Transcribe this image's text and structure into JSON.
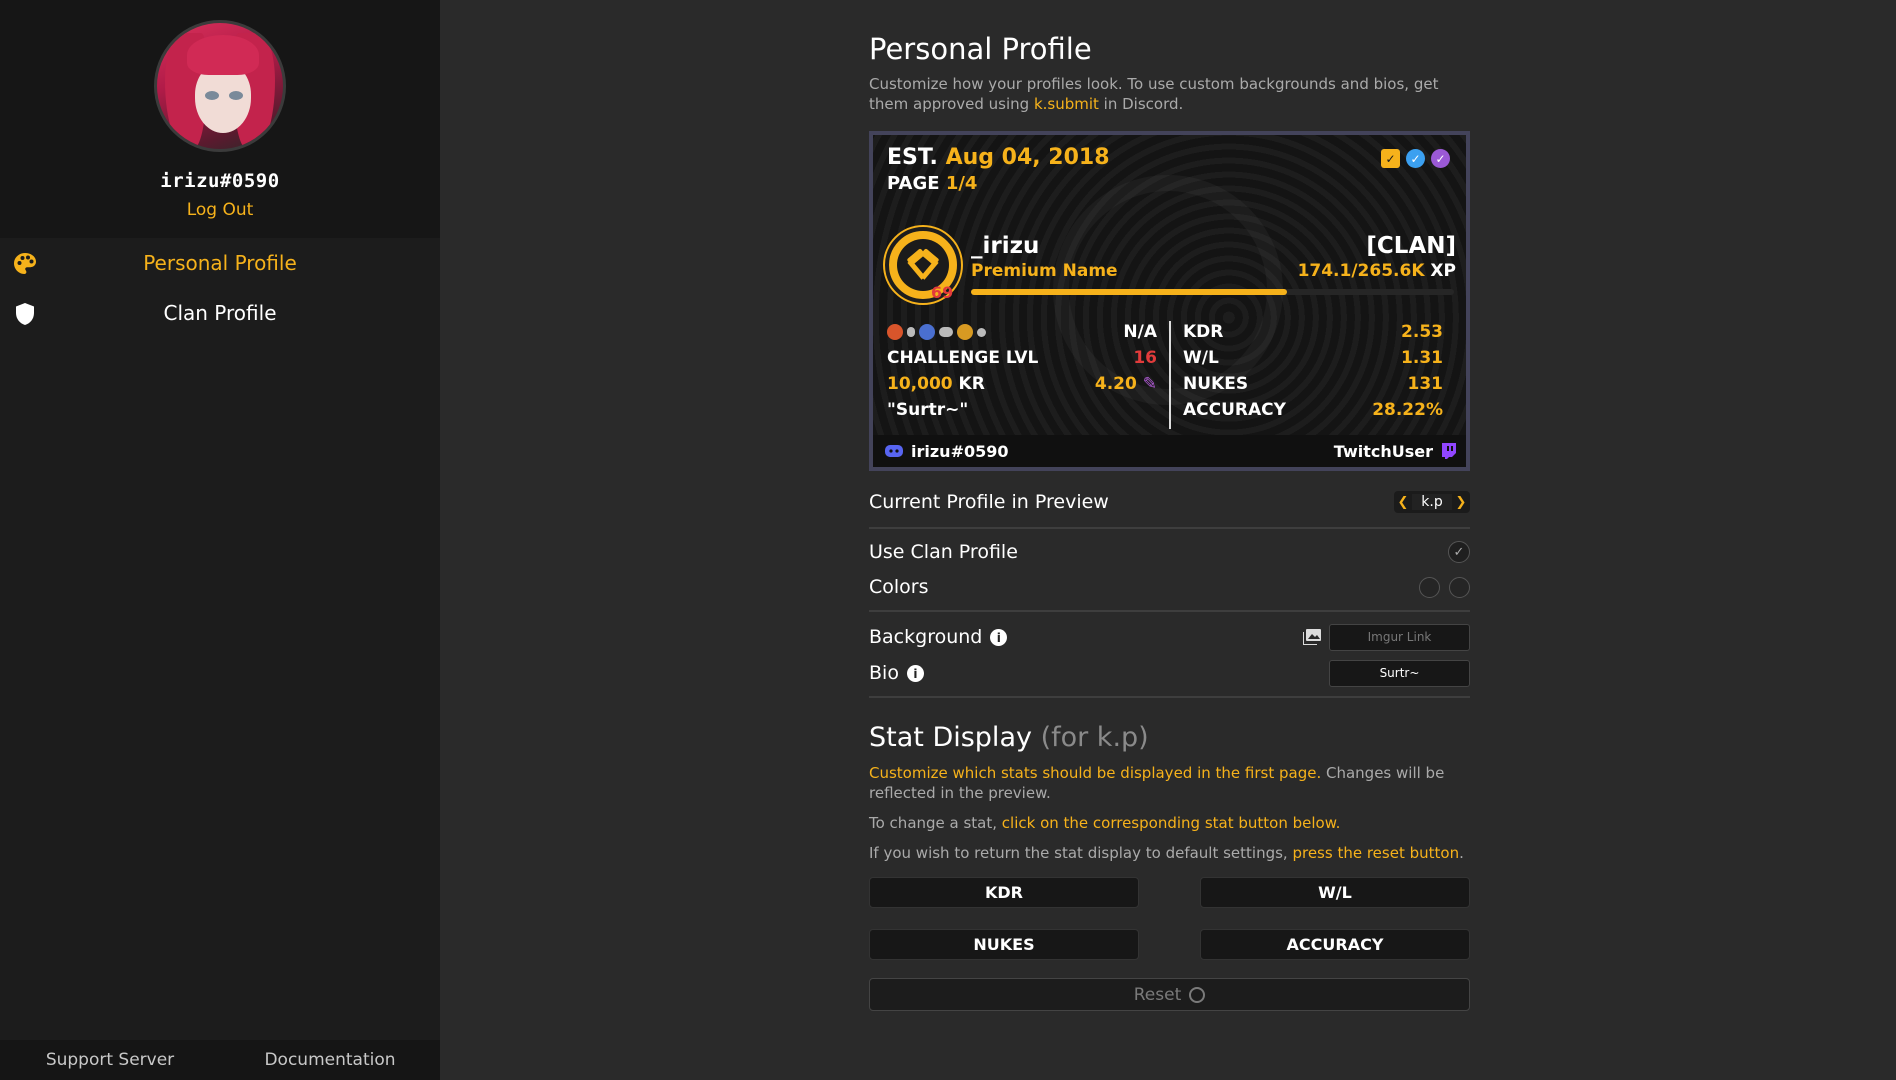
{
  "sidebar": {
    "username": "irizu#0590",
    "logout_label": "Log Out",
    "items": [
      {
        "label": "Personal Profile",
        "icon": "palette-icon",
        "active": true
      },
      {
        "label": "Clan Profile",
        "icon": "shield-icon",
        "active": false
      }
    ],
    "footer": {
      "support": "Support Server",
      "docs": "Documentation"
    }
  },
  "main": {
    "title": "Personal Profile",
    "intro_pre": "Customize how your profiles look. To use custom backgrounds and bios, get them approved using ",
    "intro_cmd": "k.submit",
    "intro_post": " in Discord.",
    "card": {
      "est_label": "EST.",
      "est_date": "Aug 04, 2018",
      "page_label": "PAGE",
      "page_value": "1/4",
      "player_name": "_irizu",
      "name_tag": "Premium Name",
      "clan": "[CLAN]",
      "xp_value": "174.1/265.6K",
      "xp_unit": "XP",
      "xp_progress": 0.655,
      "rank_number": "69",
      "left_stats": {
        "na": "N/A",
        "challenge_label": "CHALLENGE LVL",
        "challenge_value": "16",
        "kr_amount": "10,000",
        "kr_label": "KR",
        "kr_rate": "4.20",
        "bio_quote": "\"Surtr~\""
      },
      "right_stats": [
        {
          "label": "KDR",
          "value": "2.53"
        },
        {
          "label": "W/L",
          "value": "1.31"
        },
        {
          "label": "NUKES",
          "value": "131"
        },
        {
          "label": "ACCURACY",
          "value": "28.22%"
        }
      ],
      "discord": "irizu#0590",
      "twitch": "TwitchUser"
    },
    "settings": {
      "preview_label": "Current Profile in Preview",
      "preview_value": "k.p",
      "use_clan_label": "Use Clan Profile",
      "colors_label": "Colors",
      "background_label": "Background",
      "background_placeholder": "Imgur Link",
      "bio_label": "Bio",
      "bio_value": "Surtr~"
    },
    "stat_display": {
      "title": "Stat Display",
      "subtitle": "(for k.p)",
      "p1_hl": "Customize which stats should be displayed in the first page.",
      "p1_rest": " Changes will be reflected in the preview.",
      "p2_pre": "To change a stat, ",
      "p2_hl": "click on the corresponding stat button below.",
      "p3_pre": "If you wish to return the stat display to default settings, ",
      "p3_hl": "press the reset button",
      "p3_post": ".",
      "buttons": [
        "KDR",
        "W/L",
        "NUKES",
        "ACCURACY"
      ],
      "reset_label": "Reset"
    }
  },
  "colors": {
    "accent": "#f6b21b",
    "discord": "#5865f2",
    "twitch": "#9146ff",
    "badge_blue": "#3ba0f0",
    "badge_purple": "#9b59d6",
    "red": "#e23b3b"
  }
}
